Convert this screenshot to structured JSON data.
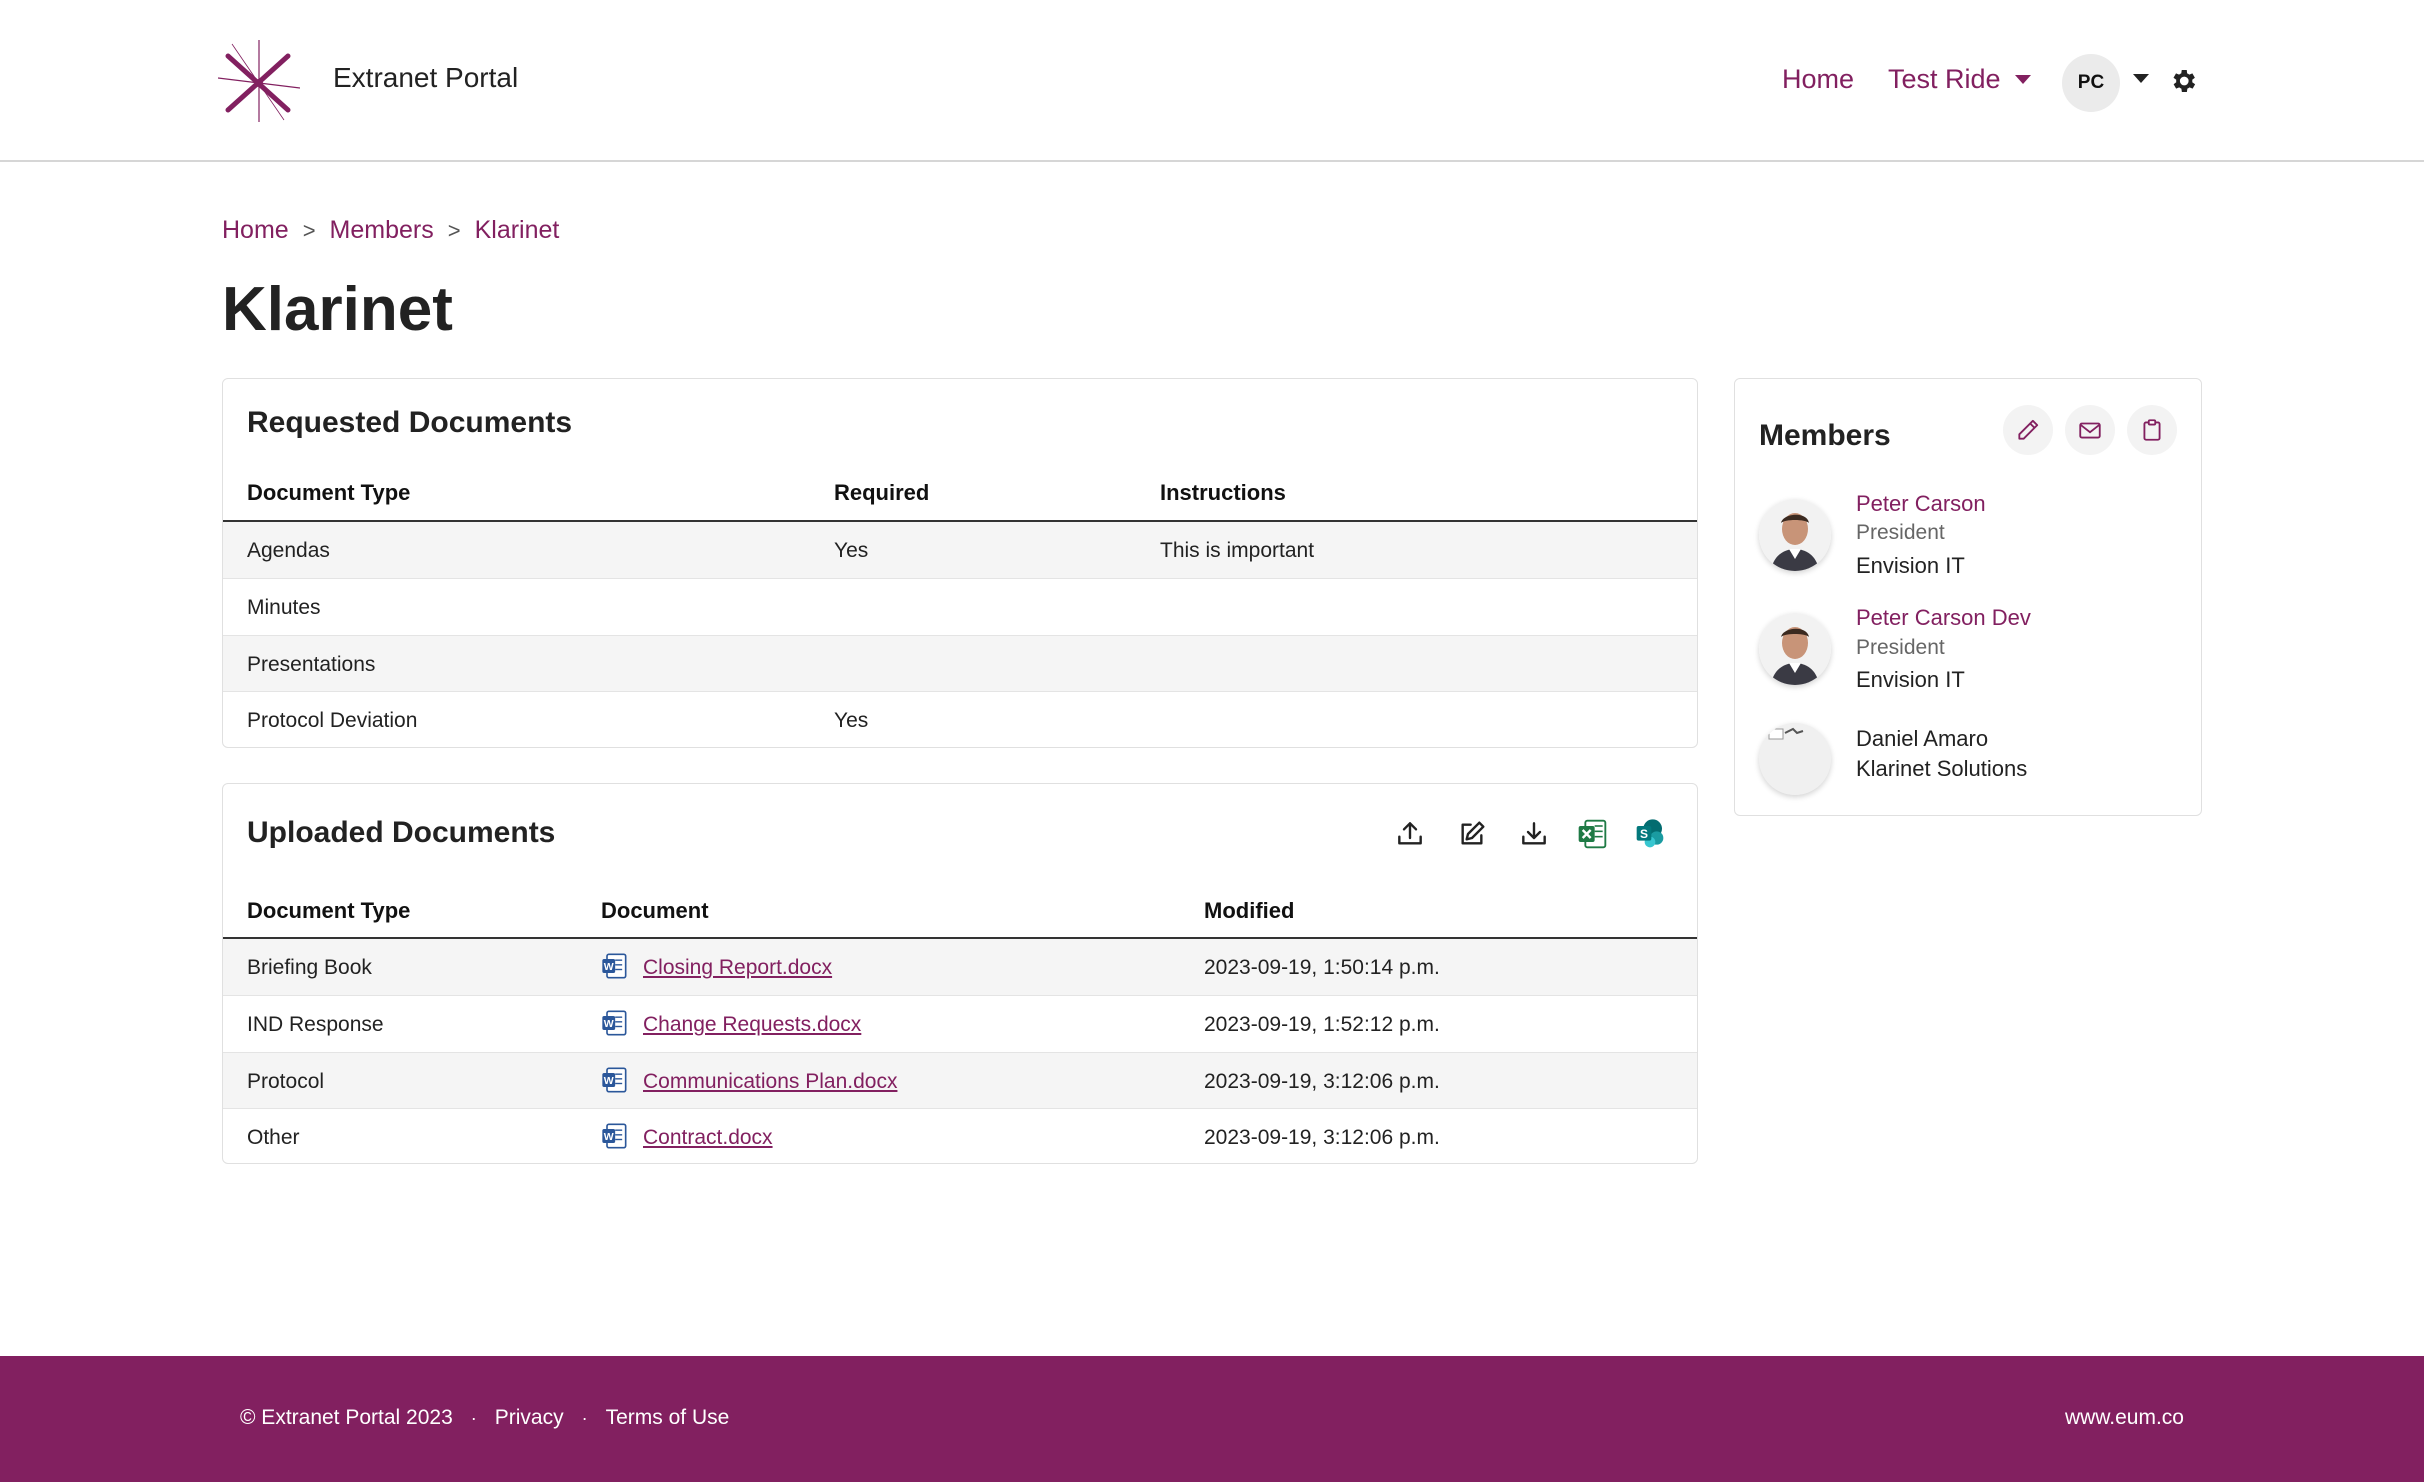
{
  "header": {
    "brand": "Extranet Portal",
    "nav_home": "Home",
    "nav_test_ride": "Test Ride",
    "user_initials": "PC"
  },
  "breadcrumb": [
    "Home",
    "Members",
    "Klarinet"
  ],
  "page_title": "Klarinet",
  "requested": {
    "title": "Requested Documents",
    "columns": [
      "Document Type",
      "Required",
      "Instructions"
    ],
    "rows": [
      {
        "type": "Agendas",
        "required": "Yes",
        "instructions": "This is important"
      },
      {
        "type": "Minutes",
        "required": "",
        "instructions": ""
      },
      {
        "type": "Presentations",
        "required": "",
        "instructions": ""
      },
      {
        "type": "Protocol Deviation",
        "required": "Yes",
        "instructions": ""
      }
    ]
  },
  "uploaded": {
    "title": "Uploaded Documents",
    "toolbar_icons": [
      "upload-icon",
      "edit-icon",
      "download-icon",
      "excel-icon",
      "sharepoint-icon"
    ],
    "columns": [
      "Document Type",
      "Document",
      "Modified"
    ],
    "rows": [
      {
        "type": "Briefing Book",
        "document": "Closing Report.docx",
        "modified": "2023-09-19, 1:50:14 p.m."
      },
      {
        "type": "IND Response",
        "document": "Change Requests.docx",
        "modified": "2023-09-19, 1:52:12 p.m."
      },
      {
        "type": "Protocol",
        "document": "Communications Plan.docx",
        "modified": "2023-09-19, 3:12:06 p.m."
      },
      {
        "type": "Other",
        "document": "Contract.docx",
        "modified": "2023-09-19, 3:12:06 p.m."
      }
    ]
  },
  "members": {
    "title": "Members",
    "list": [
      {
        "name": "Peter Carson",
        "role": "President",
        "org": "Envision IT"
      },
      {
        "name": "Peter Carson Dev",
        "role": "President",
        "org": "Envision IT"
      },
      {
        "name": "Daniel Amaro",
        "role": "",
        "org": "Klarinet Solutions"
      }
    ]
  },
  "footer": {
    "copyright": "© Extranet Portal 2023",
    "privacy": "Privacy",
    "terms": "Terms of Use",
    "site": "www.eum.co"
  },
  "colors": {
    "accent": "#822060",
    "footer_bg": "#822060"
  }
}
